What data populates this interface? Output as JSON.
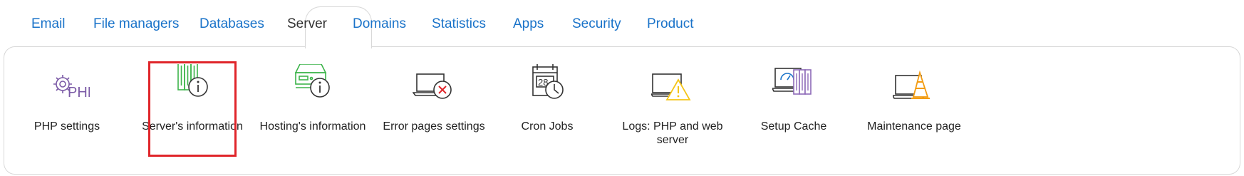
{
  "tabs": [
    {
      "label": "Email"
    },
    {
      "label": "File managers"
    },
    {
      "label": "Databases"
    },
    {
      "label": "Server"
    },
    {
      "label": "Domains"
    },
    {
      "label": "Statistics"
    },
    {
      "label": "Apps"
    },
    {
      "label": "Security"
    },
    {
      "label": "Product"
    }
  ],
  "active_tab": "Server",
  "items": [
    {
      "label": "PHP settings",
      "icon": "php-gear-icon"
    },
    {
      "label": "Server's information",
      "icon": "server-info-icon"
    },
    {
      "label": "Hosting's information",
      "icon": "hosting-info-icon"
    },
    {
      "label": "Error pages settings",
      "icon": "laptop-error-icon"
    },
    {
      "label": "Cron Jobs",
      "icon": "calendar-clock-icon"
    },
    {
      "label": "Logs: PHP and web server",
      "icon": "monitor-warning-icon"
    },
    {
      "label": "Setup Cache",
      "icon": "laptop-server-icon"
    },
    {
      "label": "Maintenance page",
      "icon": "laptop-cone-icon"
    }
  ],
  "selected_item": "Server's information",
  "colors": {
    "tab_link": "#1a73c9",
    "tab_active": "#333333",
    "highlight": "#e0252a",
    "php_purple": "#7b5aa6",
    "server_green": "#3cb44a",
    "error_red": "#e0252a",
    "warning_yellow": "#f5c518",
    "cone_orange": "#f39c12",
    "cache_purple": "#8e6ab8"
  }
}
